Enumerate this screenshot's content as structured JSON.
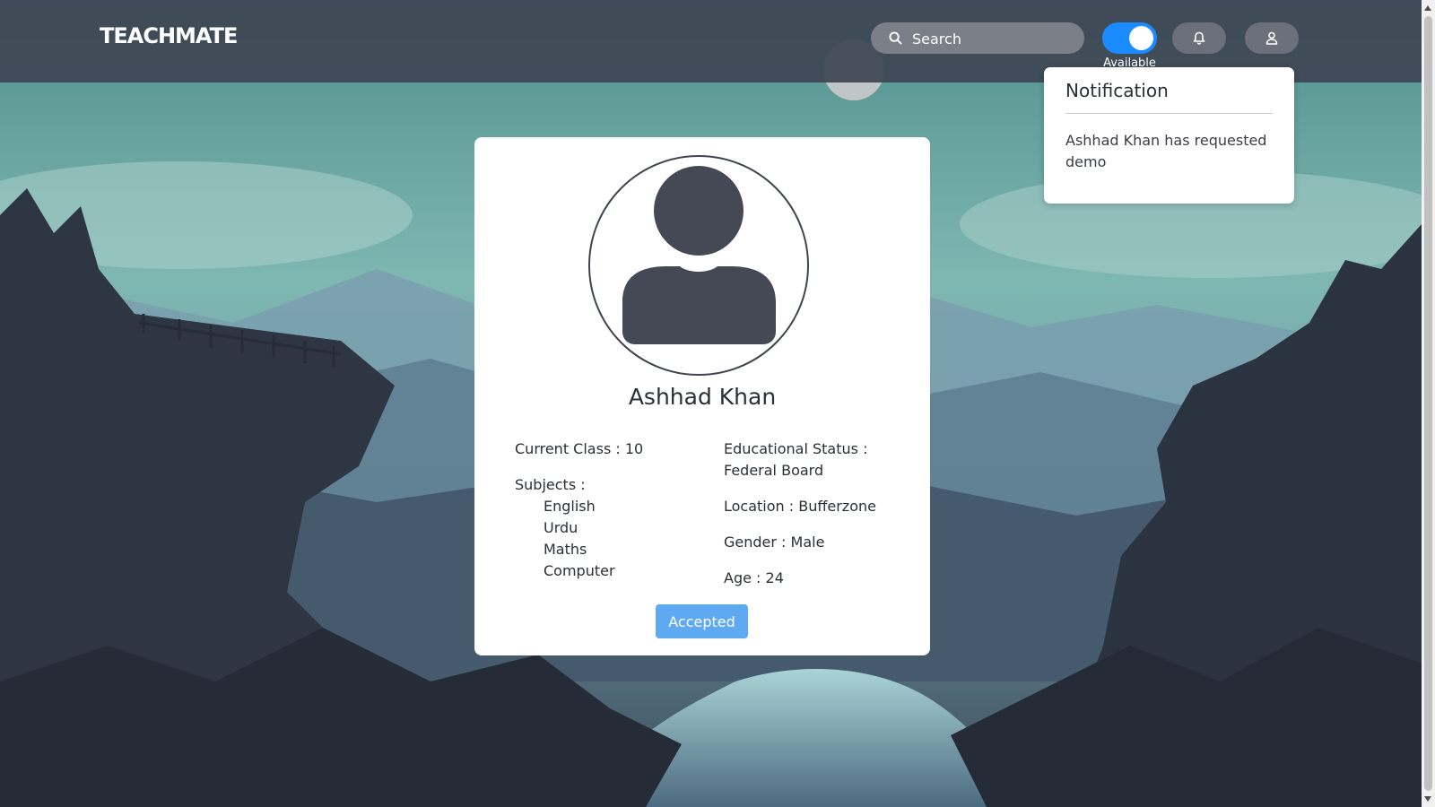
{
  "header": {
    "brand": "TEACHMATE",
    "search": {
      "placeholder": "Search",
      "value": "",
      "icon": "search-icon"
    },
    "availability_toggle": {
      "label": "Available",
      "on": true,
      "color": "#1a8cff"
    },
    "notifications_button": {
      "icon": "bell-icon"
    },
    "user_button": {
      "icon": "user-icon"
    }
  },
  "notification_panel": {
    "title": "Notification",
    "message": "Ashhad Khan has requested demo"
  },
  "profile": {
    "name": "Ashhad Khan",
    "avatar_icon": "user-avatar-icon",
    "current_class": "Current Class : 10",
    "subjects_label": "Subjects :",
    "subjects": [
      "English",
      "Urdu",
      "Maths",
      "Computer"
    ],
    "educational_status_label": "Educational Status :",
    "educational_status_value": "Federal Board",
    "location": "Location : Bufferzone",
    "gender": "Gender : Male",
    "age": "Age : 24",
    "status_button": "Accepted"
  },
  "colors": {
    "topbar": "#3e4654",
    "accent_blue": "#1a8cff",
    "button_blue": "#5ea9f0",
    "avatar_fill": "#454955"
  }
}
